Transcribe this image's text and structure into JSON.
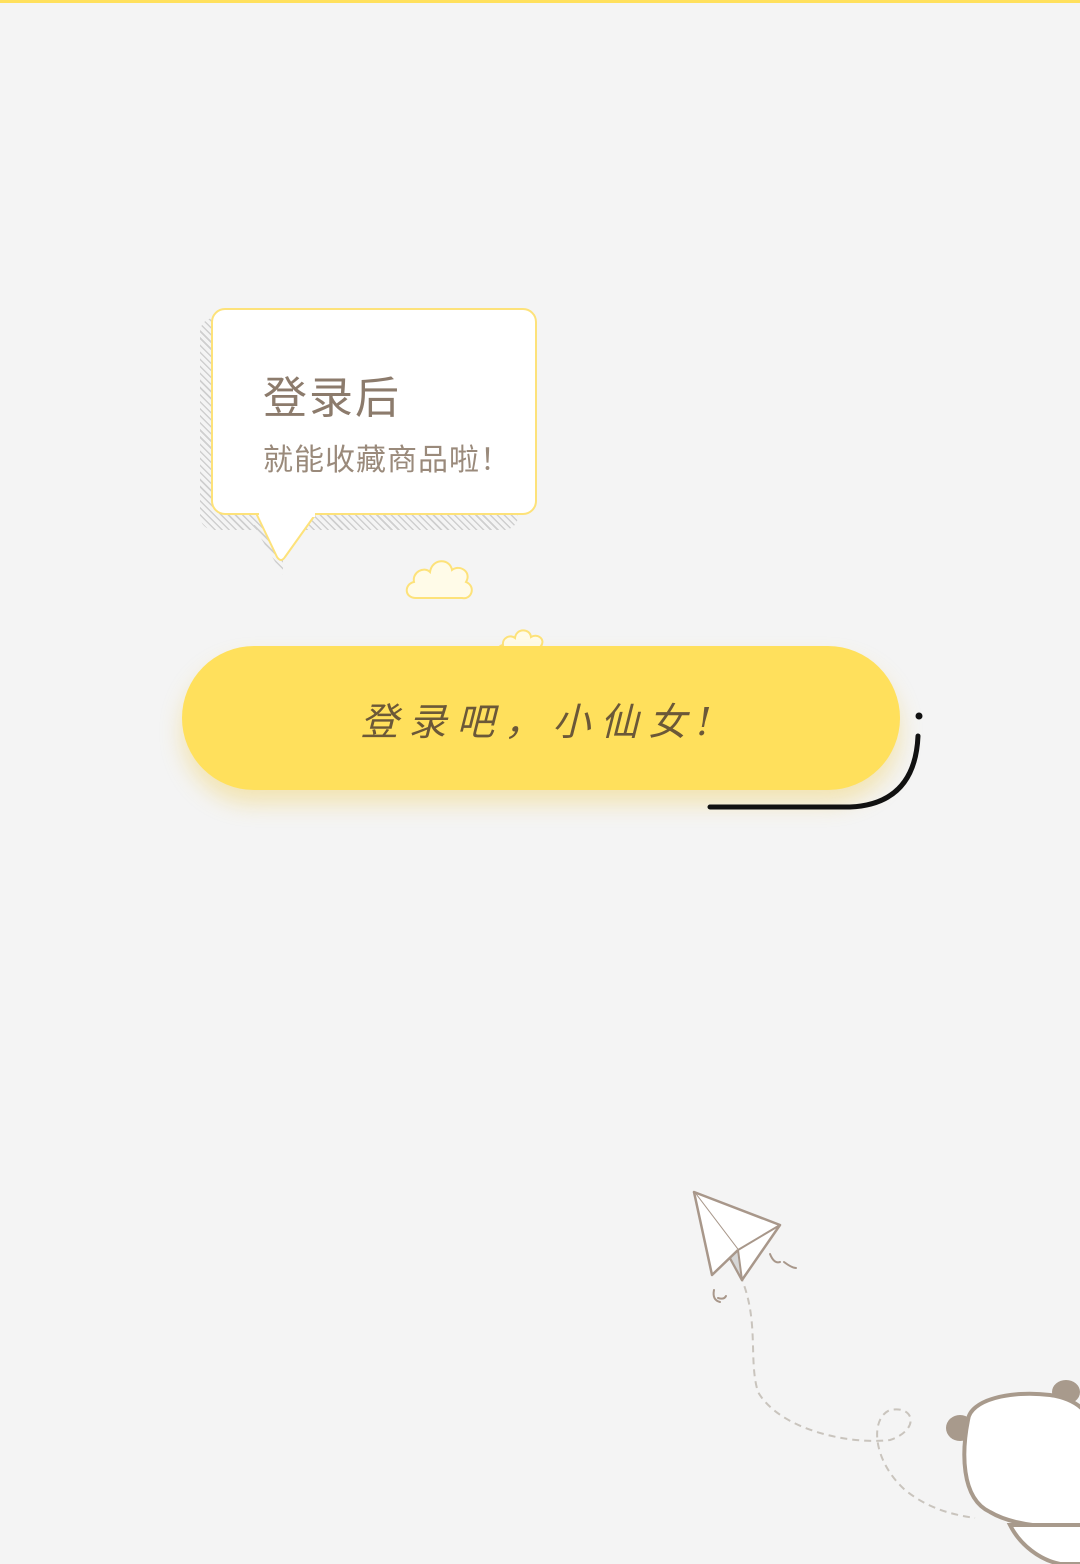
{
  "prompt_bubble": {
    "title": "登录后",
    "subtitle": "就能收藏商品啦！"
  },
  "login_button": {
    "label": "登录吧，小仙女!"
  },
  "colors": {
    "accent": "#ffe05c",
    "bubble_border": "#fde27a",
    "text_brown": "#8c7b6c",
    "background": "#f4f4f4"
  },
  "icons": [
    "cloud-icon",
    "paper-plane-icon",
    "panda-icon"
  ]
}
